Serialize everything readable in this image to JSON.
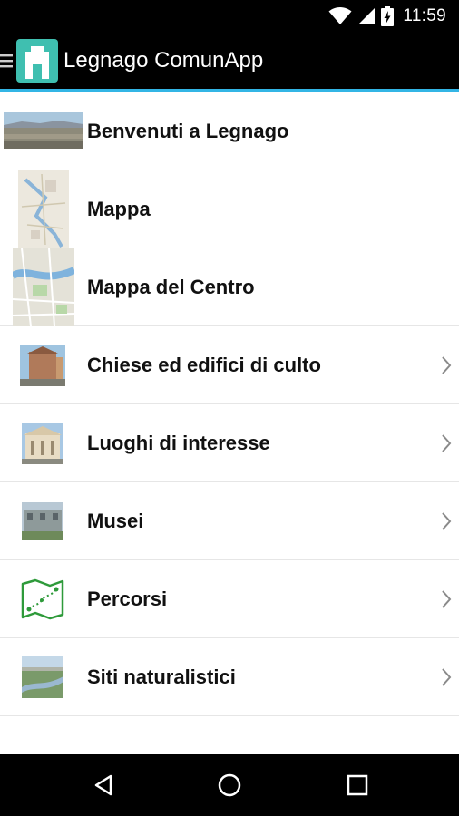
{
  "status_bar": {
    "time": "11:59",
    "icons": [
      "wifi-icon",
      "signal-icon",
      "battery-charging-icon"
    ]
  },
  "app_bar": {
    "title": "Legnago ComunApp",
    "accent_color": "#33b5e5",
    "logo_color": "#3fbfb0"
  },
  "menu": {
    "items": [
      {
        "label": "Benvenuti a Legnago",
        "thumb": "panorama-photo",
        "chevron": false
      },
      {
        "label": "Mappa",
        "thumb": "map-photo",
        "chevron": false
      },
      {
        "label": "Mappa del Centro",
        "thumb": "center-map-photo",
        "chevron": false
      },
      {
        "label": "Chiese ed edifici di culto",
        "thumb": "church-photo",
        "chevron": true
      },
      {
        "label": "Luoghi di interesse",
        "thumb": "theater-photo",
        "chevron": true
      },
      {
        "label": "Musei",
        "thumb": "museum-photo",
        "chevron": true
      },
      {
        "label": "Percorsi",
        "thumb": "route-map-icon",
        "chevron": true
      },
      {
        "label": "Siti naturalistici",
        "thumb": "river-photo",
        "chevron": true
      }
    ]
  },
  "nav_bar": {
    "buttons": [
      "back-icon",
      "home-icon",
      "recents-icon"
    ]
  }
}
